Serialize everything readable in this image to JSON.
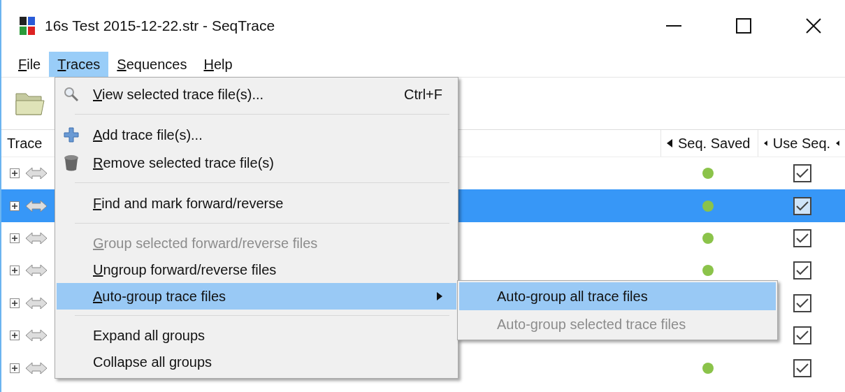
{
  "window": {
    "title": "16s Test 2015-12-22.str - SeqTrace"
  },
  "menubar": [
    {
      "label": "File",
      "selected": false
    },
    {
      "label": "Traces",
      "selected": true
    },
    {
      "label": "Sequences",
      "selected": false
    },
    {
      "label": "Help",
      "selected": false
    }
  ],
  "table": {
    "columns": [
      {
        "label": "Trace"
      },
      {
        "label": "Seq. Saved",
        "sort_arrow": true
      },
      {
        "label": "Use Seq.",
        "sort_arrow": true
      }
    ],
    "rows": [
      {
        "selected": false,
        "color": "#8bc34a",
        "use": true
      },
      {
        "selected": true,
        "color": "#8bc34a",
        "use": true
      },
      {
        "selected": false,
        "color": "#8bc34a",
        "use": true
      },
      {
        "selected": false,
        "color": "#8bc34a",
        "use": true
      },
      {
        "selected": false,
        "use": true
      },
      {
        "selected": false,
        "use": true
      },
      {
        "selected": false,
        "color": "#8bc34a",
        "use": true
      }
    ]
  },
  "menu": [
    {
      "kind": "item",
      "label": "View selected trace file(s)...",
      "underline_first": true,
      "shortcut": "Ctrl+F",
      "disabled": false,
      "selected": false
    },
    {
      "kind": "separator"
    },
    {
      "kind": "item",
      "label": "Add trace file(s)...",
      "underline_first": true,
      "disabled": false,
      "selected": false
    },
    {
      "kind": "item",
      "label": "Remove selected trace file(s)",
      "underline_first": true,
      "disabled": false,
      "selected": false
    },
    {
      "kind": "separator"
    },
    {
      "kind": "item",
      "label": "Find and mark forward/reverse",
      "underline_first": true,
      "disabled": false,
      "selected": false
    },
    {
      "kind": "separator"
    },
    {
      "kind": "item",
      "label": "Group selected forward/reverse files",
      "underline_first": true,
      "disabled": true,
      "selected": false
    },
    {
      "kind": "item",
      "label": "Ungroup forward/reverse files",
      "underline_first": true,
      "disabled": false,
      "selected": false
    },
    {
      "kind": "submenu",
      "label": "Auto-group trace files",
      "underline_first": true,
      "disabled": false,
      "selected": true
    },
    {
      "kind": "separator"
    },
    {
      "kind": "item",
      "label": "Expand all groups",
      "underline_first": false,
      "disabled": false,
      "selected": false
    },
    {
      "kind": "item",
      "label": "Collapse all groups",
      "underline_first": false,
      "disabled": false,
      "selected": false
    }
  ],
  "submenu": [
    {
      "label": "Auto-group all trace files",
      "disabled": false,
      "selected": true
    },
    {
      "label": "Auto-group selected trace files",
      "disabled": true,
      "selected": false
    }
  ]
}
